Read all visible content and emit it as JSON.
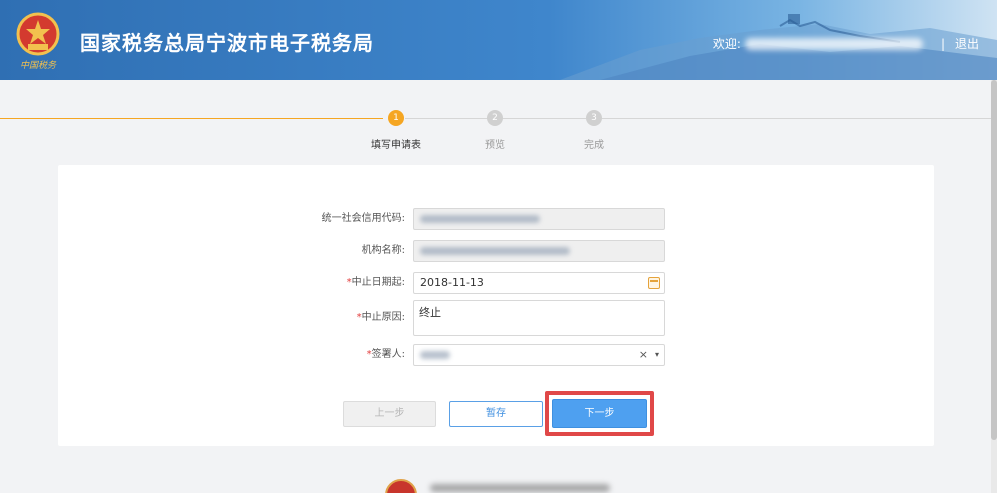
{
  "header": {
    "title": "国家税务总局宁波市电子税务局",
    "welcome": "欢迎:",
    "separator": "|",
    "logout": "退出"
  },
  "steps": [
    {
      "number": "1",
      "label": "填写申请表",
      "active": true
    },
    {
      "number": "2",
      "label": "预览",
      "active": false
    },
    {
      "number": "3",
      "label": "完成",
      "active": false
    }
  ],
  "form": {
    "credit_code_label": "统一社会信用代码:",
    "org_name_label": "机构名称:",
    "date_label": "中止日期起:",
    "date_value": "2018-11-13",
    "reason_label": "中止原因:",
    "reason_value": "终止",
    "signer_label": "签署人:",
    "required_mark": "*",
    "clear_symbol": "×",
    "arrow_symbol": "▾"
  },
  "buttons": {
    "prev": "上一步",
    "save": "暂存",
    "next": "下一步"
  },
  "colors": {
    "accent_orange": "#f5a623",
    "primary_blue": "#4ea0f0",
    "highlight_red": "#e04848"
  }
}
